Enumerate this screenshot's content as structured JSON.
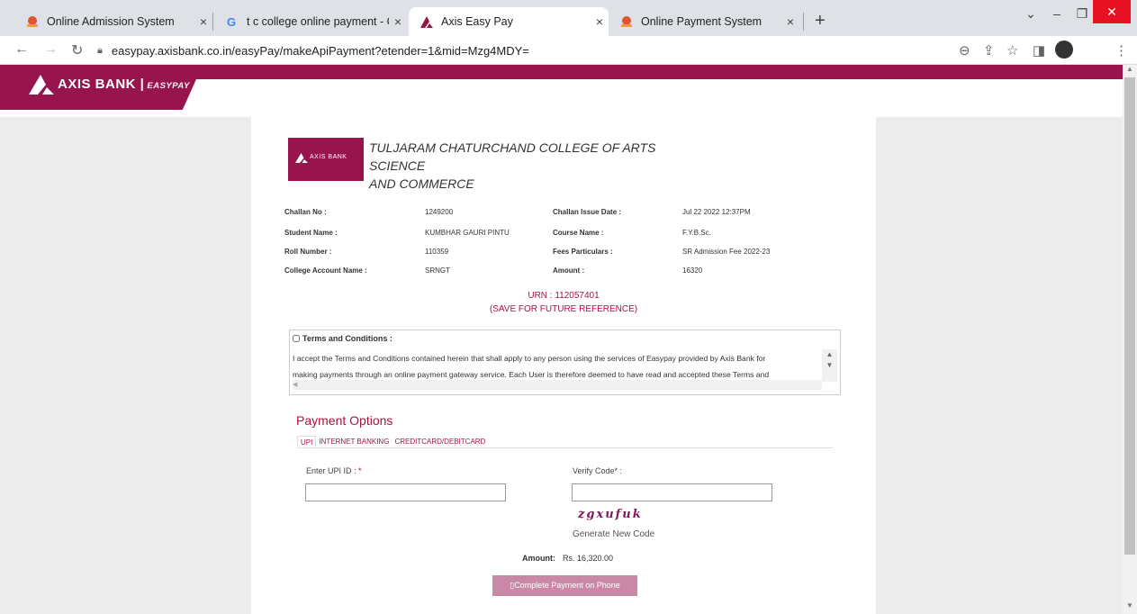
{
  "browser": {
    "tabs": [
      {
        "title": "Online Admission System",
        "icon": "admission-icon"
      },
      {
        "title": "t c college online payment - Goo",
        "icon": "google-icon"
      },
      {
        "title": "Axis Easy Pay",
        "icon": "axis-icon",
        "active": true
      },
      {
        "title": "Online Payment System",
        "icon": "admission-icon"
      }
    ],
    "url": "easypay.axisbank.co.in/easyPay/makeApiPayment?etender=1&mid=Mzg4MDY=",
    "new_tab": "+",
    "tab_close": "×"
  },
  "banner": {
    "brand": "AXIS BANK |",
    "sub": "EASYPAY"
  },
  "college": {
    "logo_text": "AXIS BANK",
    "name_line1": "TULJARAM CHATURCHAND COLLEGE OF ARTS SCIENCE",
    "name_line2": "AND COMMERCE"
  },
  "challan": {
    "left_labels": [
      "Challan No :",
      "Student Name :",
      "Roll Number :",
      "College Account Name :"
    ],
    "left_values": [
      "1249200",
      "KUMBHAR GAURI PINTU",
      "110359",
      "SRNGT"
    ],
    "right_labels": [
      "Challan Issue Date :",
      "Course Name :",
      "Fees Particulars :",
      "Amount :"
    ],
    "right_values": [
      "Jul 22 2022 12:37PM",
      "F.Y.B.Sc.",
      "SR Admission Fee 2022-23",
      "16320"
    ]
  },
  "urn": {
    "line1": "URN : 112057401",
    "line2": "(SAVE FOR FUTURE REFERENCE)"
  },
  "terms": {
    "heading": "Terms and Conditions :",
    "line1": "I accept the Terms and Conditions contained herein that shall apply to any person using the services of Easypay provided by Axis Bank for",
    "line2": "making payments through an online payment gateway service. Each User is therefore deemed to have read and accepted these Terms and"
  },
  "payment": {
    "heading": "Payment Options",
    "tabs": [
      "UPI",
      "INTERNET BANKING",
      "CREDITCARD/DEBITCARD"
    ],
    "upi_label": "Enter UPI ID :",
    "required_mark": "*",
    "verify_label": "Verify Code* :",
    "captcha": "zgxufuk",
    "generate_label": "Generate New Code",
    "amount_label": "Amount:",
    "amount_value": "Rs. 16,320.00",
    "submit_label": "Complete Payment on Phone"
  },
  "colors": {
    "brand": "#97144d",
    "accent_text": "#a5143e"
  }
}
